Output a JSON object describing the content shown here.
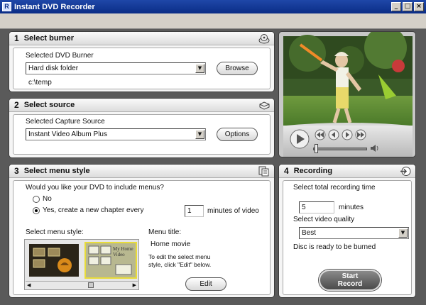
{
  "window": {
    "title": "Instant DVD Recorder",
    "controls": [
      "_",
      "□",
      "×"
    ]
  },
  "burner": {
    "number": "1",
    "title": "Select burner",
    "icon": "disc-icon",
    "field_label": "Selected DVD Burner",
    "selected": "Hard disk folder",
    "button": "Browse",
    "path": "c:\\temp"
  },
  "source": {
    "number": "2",
    "title": "Select source",
    "icon": "drive-icon",
    "field_label": "Selected Capture Source",
    "selected": "Instant Video Album Plus",
    "button": "Options"
  },
  "menu": {
    "number": "3",
    "title": "Select menu style",
    "icon": "menu-style-icon",
    "question": "Would you like your DVD to include menus?",
    "option_no": "No",
    "option_yes": "Yes, create a new chapter every",
    "selected_option": "yes",
    "chapter_minutes": "1",
    "minutes_suffix": "minutes of video",
    "style_label": "Select menu style:",
    "menu_title_label": "Menu title:",
    "menu_title_value": "Home movie",
    "edit_hint": "To edit the select menu style, click \"Edit\" below.",
    "edit_button": "Edit",
    "thumb_text": "My Home Video"
  },
  "recording": {
    "number": "4",
    "title": "Recording",
    "icon": "record-icon",
    "time_label": "Select total recording time",
    "minutes_value": "5",
    "minutes_label": "minutes",
    "quality_label": "Select video quality",
    "quality_value": "Best",
    "status": "Disc is ready to be burned",
    "start_button": "Start Record"
  },
  "colors": {
    "titlebar": "#0a2d86",
    "frame": "#5a5a5a",
    "panel": "#f5f5f5"
  }
}
